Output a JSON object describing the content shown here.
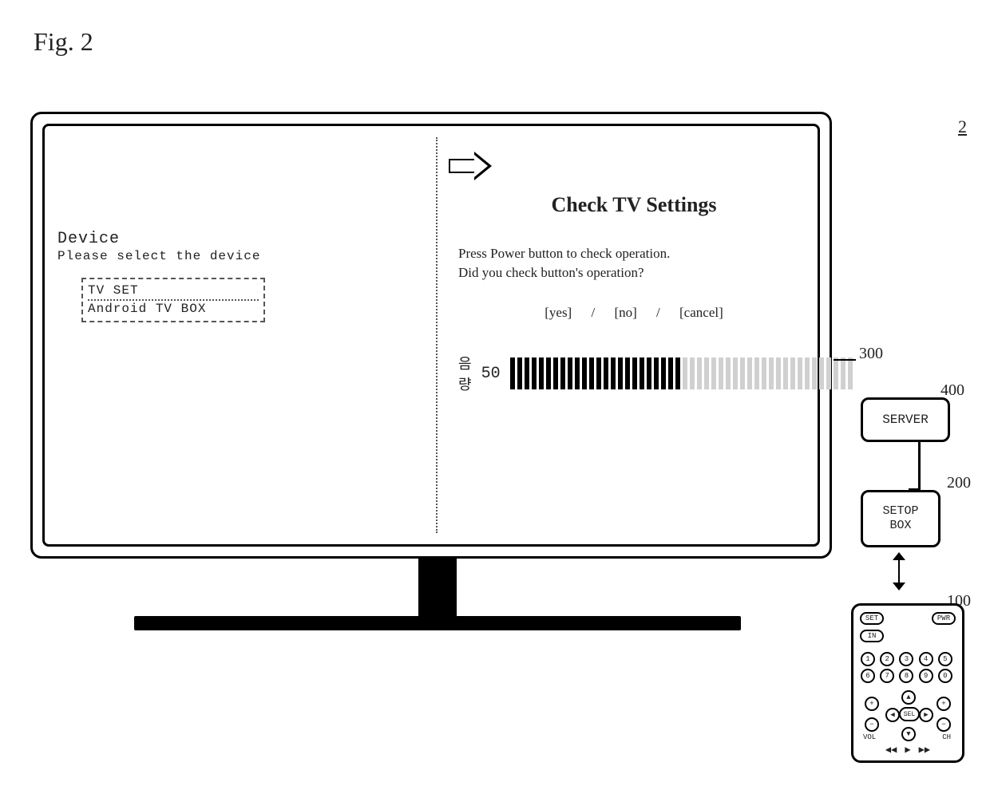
{
  "figure_label": "Fig. 2",
  "reference_numbers": {
    "system": "2",
    "tv": "300",
    "server": "400",
    "settop_box": "200",
    "remote": "100"
  },
  "screen": {
    "left": {
      "heading": "Device",
      "prompt": "Please select the device",
      "options": [
        "TV SET",
        "Android TV BOX"
      ],
      "selected_index": 0
    },
    "right": {
      "title": "Check TV Settings",
      "line1": "Press Power button to check operation.",
      "line2": "Did you check button's operation?",
      "choices": {
        "yes": "[yes]",
        "no": "[no]",
        "cancel": "[cancel]"
      },
      "separator": "/",
      "volume": {
        "label": "음량",
        "value": 50,
        "max": 100,
        "filled_bars": 24,
        "total_bars": 48
      }
    }
  },
  "server": {
    "label": "SERVER"
  },
  "settop_box": {
    "label": "SETOP\nBOX"
  },
  "remote": {
    "set": "SET",
    "pwr": "PWR",
    "in": "IN",
    "numbers": [
      "1",
      "2",
      "3",
      "4",
      "5",
      "6",
      "7",
      "8",
      "9",
      "0"
    ],
    "vol_label": "VOL",
    "ch_label": "CH",
    "select": "SEL",
    "plus": "+",
    "minus": "−",
    "up": "▲",
    "down": "▼",
    "left": "◀",
    "right": "▶",
    "media": {
      "prev": "◀◀",
      "play": "▶",
      "next": "▶▶"
    }
  }
}
